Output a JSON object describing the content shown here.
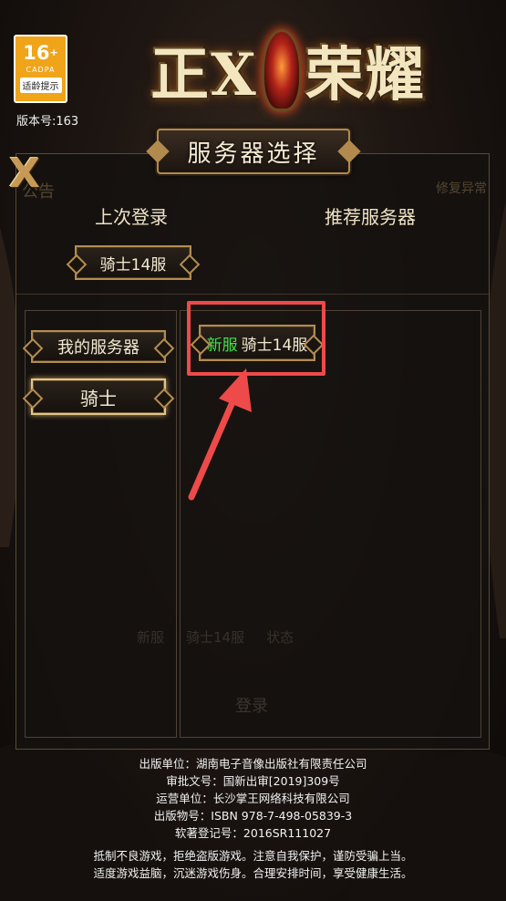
{
  "rating": {
    "age": "16",
    "plus": "+",
    "org": "CADPA",
    "tip": "适龄提示"
  },
  "version": "版本号:163",
  "logo": {
    "left": "正X",
    "right": "荣耀"
  },
  "dialog": {
    "title": "服务器选择",
    "close_label": "X",
    "ghost_left": "公告",
    "ghost_right": "修复异常"
  },
  "columns": {
    "last_login": "上次登录",
    "recommended": "推荐服务器"
  },
  "last_login_server": "骑士14服",
  "categories": [
    {
      "label": "我的服务器",
      "selected": false
    },
    {
      "label": "骑士",
      "selected": true
    }
  ],
  "servers": [
    {
      "tag": "新服",
      "name": "骑士14服",
      "tag_color": "#3fe24a"
    }
  ],
  "faint_background": {
    "row": [
      "新服",
      "骑士14服",
      "状态"
    ],
    "login": "登录"
  },
  "annotation": {
    "box_color": "#ee4a4a"
  },
  "footer": [
    "出版单位：湖南电子音像出版社有限责任公司",
    "审批文号：国新出审[2019]309号",
    "运营单位：长沙掌王网络科技有限公司",
    "出版物号：ISBN 978-7-498-05839-3",
    "软著登记号：2016SR111027",
    "抵制不良游戏，拒绝盗版游戏。注意自我保护，谨防受骗上当。",
    "适度游戏益脑，沉迷游戏伤身。合理安排时间，享受健康生活。"
  ]
}
